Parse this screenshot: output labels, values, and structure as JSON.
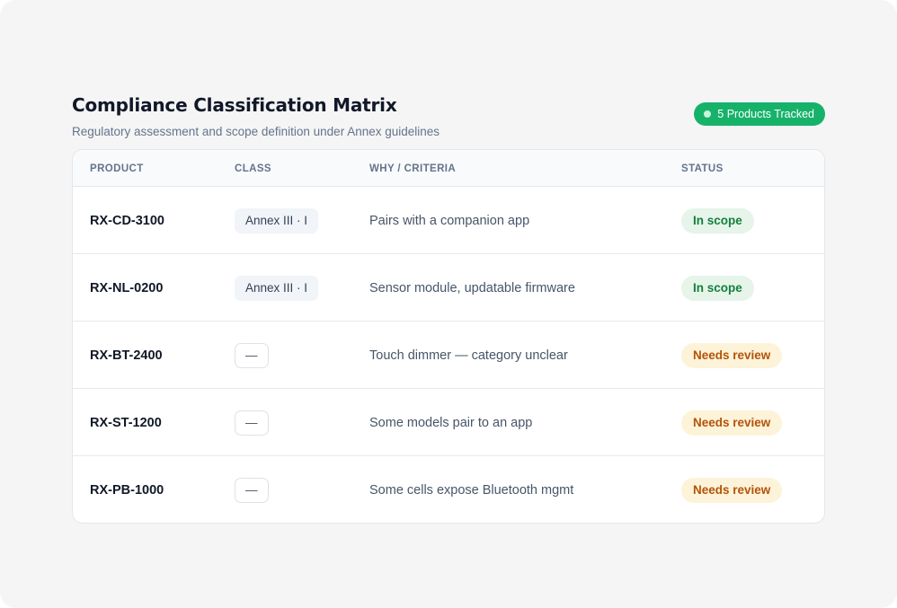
{
  "header": {
    "title": "Compliance Classification Matrix",
    "subtitle": "Regulatory assessment and scope definition under Annex guidelines",
    "tracked_badge": "5 Products Tracked"
  },
  "table": {
    "columns": {
      "product": "PRODUCT",
      "class": "CLASS",
      "why": "WHY / CRITERIA",
      "status": "STATUS"
    },
    "rows": [
      {
        "product": "RX-CD-3100",
        "class": "Annex III · I",
        "why": "Pairs with a companion app",
        "status": "In scope"
      },
      {
        "product": "RX-NL-0200",
        "class": "Annex III · I",
        "why": "Sensor module, updatable firmware",
        "status": "In scope"
      },
      {
        "product": "RX-BT-2400",
        "class": "—",
        "why": "Touch dimmer — category unclear",
        "status": "Needs review"
      },
      {
        "product": "RX-ST-1200",
        "class": "—",
        "why": "Some models pair to an app",
        "status": "Needs review"
      },
      {
        "product": "RX-PB-1000",
        "class": "—",
        "why": "Some cells expose Bluetooth mgmt",
        "status": "Needs review"
      }
    ]
  },
  "colors": {
    "badge_green": "#17b26a",
    "in_scope_text": "#15803d",
    "in_scope_bg": "#e6f4ea",
    "review_text": "#b45309",
    "review_bg": "#fdf3d9"
  }
}
